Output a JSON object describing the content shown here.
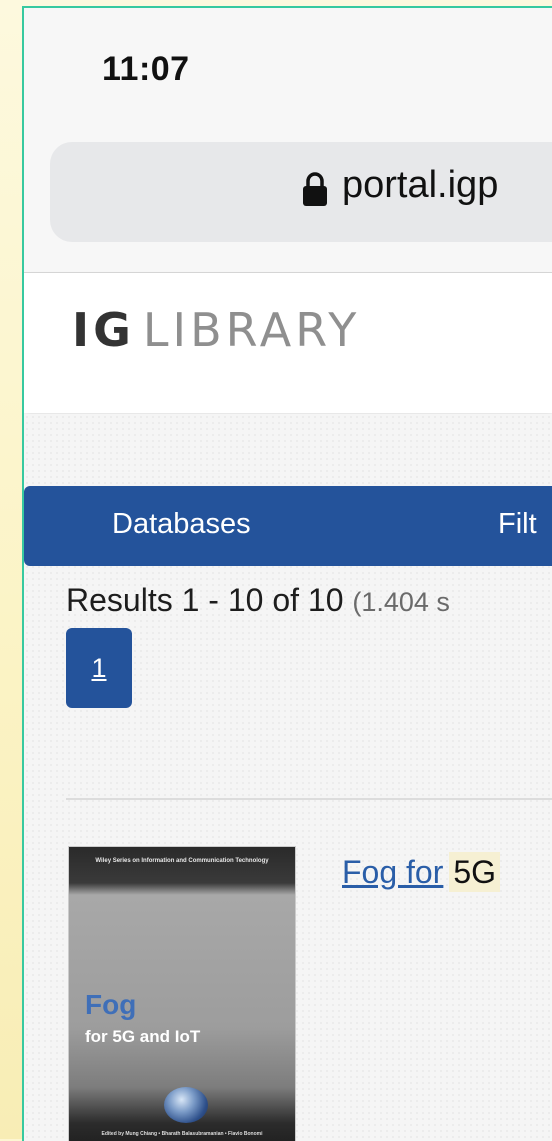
{
  "status_bar": {
    "time": "11:07"
  },
  "browser": {
    "url": "portal.igp"
  },
  "site": {
    "logo_bold": "IG",
    "logo_light": "LIBRARY"
  },
  "nav": {
    "databases": "Databases",
    "filter": "Filt"
  },
  "results": {
    "summary": "Results 1 - 10 of 10",
    "time": "(1.404 s"
  },
  "pagination": {
    "current": "1"
  },
  "result_item": {
    "title_link": "Fog for",
    "title_highlight": "5G",
    "cover": {
      "series": "Wiley Series on Information and Communication Technology",
      "title": "Fog",
      "subtitle": "for 5G and IoT",
      "editors": "Edited by Mung Chiang • Bharath Balasubramanian • Flavio Bonomi"
    }
  },
  "colors": {
    "nav_blue": "#24539b",
    "link_blue": "#2a5ea8",
    "highlight": "#f6f0d3",
    "frame_border": "#37c9a0"
  },
  "icons": {
    "url_bar": "lock-icon"
  }
}
